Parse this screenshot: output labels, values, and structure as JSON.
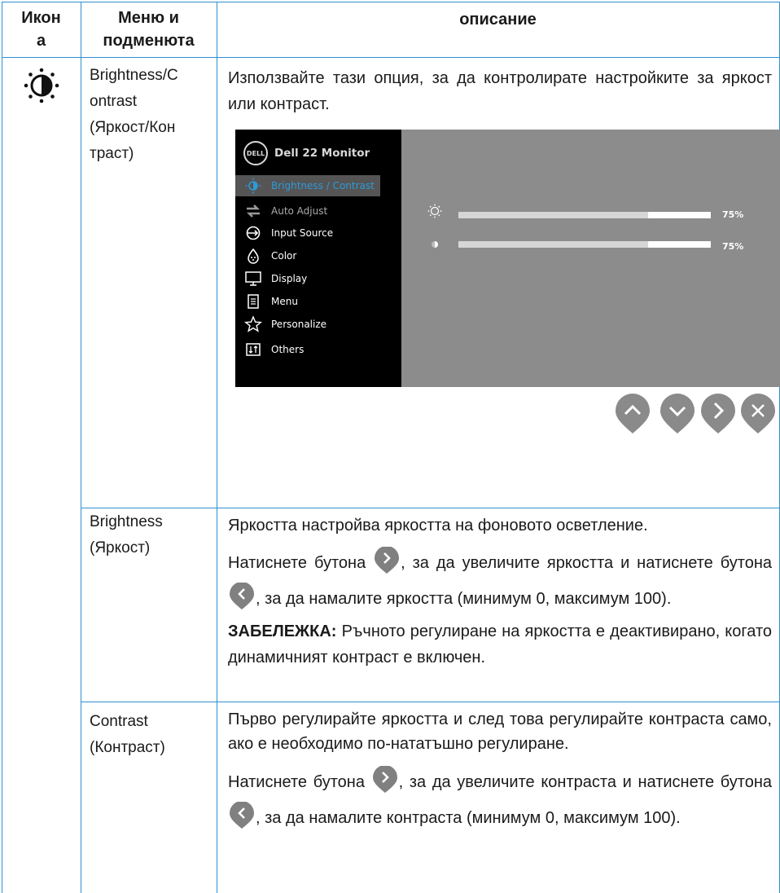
{
  "table": {
    "headers": {
      "icon": "Икон\nа",
      "menu": "Меню и\nподменюта",
      "desc": "описание"
    },
    "rows": [
      {
        "menu_line1": "Brightness/C",
        "menu_line2": "ontrast",
        "menu_line3": "(Яркост/Кон",
        "menu_line4": "траст)",
        "desc": "Използвайте тази опция, за да контролирате настройките за яркост или контраст."
      },
      {
        "menu_line1": "Brightness",
        "menu_line2": "(Яркост)",
        "desc_line1": "Яркостта настройва яркостта на фоновото осветление.",
        "desc_line2a": "Натиснете бутона",
        "desc_line2b": ", за да увеличите яркостта и натиснете бутона",
        "desc_line2c": ", за да намалите яркостта (минимум 0, максимум 100).",
        "note_label": "ЗАБЕЛЕЖКА:",
        "note_text": " Ръчното регулиране на яркостта е деактивирано, когато динамичният контраст е включен."
      },
      {
        "menu_line1": "Contrast",
        "menu_line2": "(Контраст)",
        "desc_line1": "Първо регулирайте яркостта и след това регулирайте контраста само, ако е необходимо по-нататъшно регулиране.",
        "desc_line2a": "Натиснете бутона",
        "desc_line2b": ", за да увеличите контраста и натиснете бутона",
        "desc_line2c": ", за да намалите контраста (минимум 0, максимум 100)."
      }
    ]
  },
  "osd": {
    "logo": "DELL",
    "title": "Dell 22 Monitor",
    "menu_items": [
      {
        "label": "Brightness / Contrast",
        "icon": "brightness-icon",
        "active": true
      },
      {
        "label": "Auto Adjust",
        "icon": "auto-adjust-icon",
        "dim": true
      },
      {
        "label": "Input Source",
        "icon": "input-source-icon"
      },
      {
        "label": "Color",
        "icon": "color-icon"
      },
      {
        "label": "Display",
        "icon": "display-icon"
      },
      {
        "label": "Menu",
        "icon": "menu-icon"
      },
      {
        "label": "Personalize",
        "icon": "star-icon"
      },
      {
        "label": "Others",
        "icon": "others-icon"
      }
    ],
    "brightness_value": "75%",
    "contrast_value": "75%",
    "brightness_level": 0.75,
    "contrast_level": 0.75
  },
  "colors": {
    "rule": "#2e8fd0",
    "osd_accent": "#2e9ad8",
    "button": "#8a8a8a"
  }
}
